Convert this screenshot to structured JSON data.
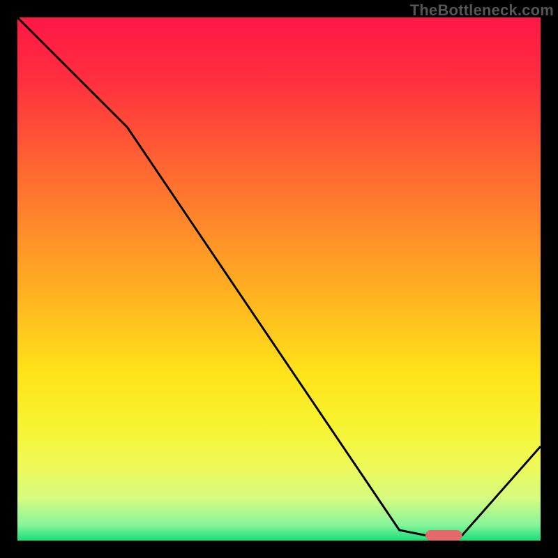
{
  "watermark": "TheBottleneck.com",
  "colors": {
    "frame_bg": "#000000",
    "curve": "#000000",
    "marker": "#e46a6a",
    "gradient_stops": [
      {
        "offset": 0.0,
        "color": "#ff1745"
      },
      {
        "offset": 0.12,
        "color": "#ff2f3f"
      },
      {
        "offset": 0.25,
        "color": "#ff5a34"
      },
      {
        "offset": 0.4,
        "color": "#ff8a2a"
      },
      {
        "offset": 0.55,
        "color": "#ffb81f"
      },
      {
        "offset": 0.68,
        "color": "#ffe31a"
      },
      {
        "offset": 0.78,
        "color": "#f7f330"
      },
      {
        "offset": 0.86,
        "color": "#eef95a"
      },
      {
        "offset": 0.92,
        "color": "#d5fb80"
      },
      {
        "offset": 0.97,
        "color": "#86f59a"
      },
      {
        "offset": 1.0,
        "color": "#18df76"
      }
    ]
  },
  "chart_data": {
    "type": "line",
    "title": "",
    "xlabel": "",
    "ylabel": "",
    "xlim": [
      0,
      100
    ],
    "ylim": [
      0,
      100
    ],
    "x": [
      0,
      21,
      73,
      78,
      85,
      100
    ],
    "series": [
      {
        "name": "bottleneck-curve",
        "values": [
          100,
          79,
          2,
          1,
          1,
          18
        ]
      }
    ],
    "marker": {
      "x_start": 78,
      "x_end": 85,
      "y": 1,
      "height": 2
    }
  }
}
